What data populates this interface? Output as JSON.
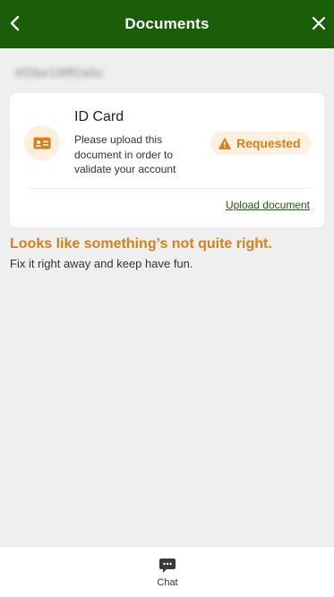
{
  "header": {
    "title": "Documents"
  },
  "account": {
    "masked_id": "#f2be19fff2a5c"
  },
  "document": {
    "title": "ID Card",
    "description": "Please upload this document in order to validate your account",
    "status": "Requested",
    "upload_label": "Upload document",
    "icon": "id-card-icon"
  },
  "alert": {
    "title": "Looks like something’s not quite right.",
    "subtitle": "Fix it right away and keep have fun."
  },
  "bottom_bar": {
    "chat_label": "Chat"
  },
  "colors": {
    "header_bg": "#1b5e0a",
    "accent_orange": "#d9801a",
    "badge_bg": "#fdf0e1",
    "page_bg": "#efefef"
  }
}
